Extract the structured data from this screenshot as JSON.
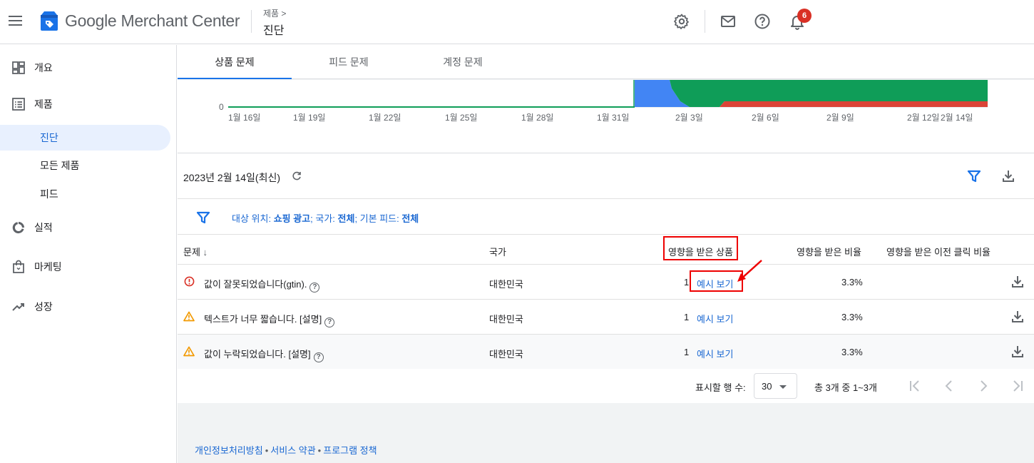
{
  "header": {
    "brand": "Google Merchant Center",
    "breadcrumb_parent": "제품 >",
    "breadcrumb_current": "진단",
    "notification_count": "6"
  },
  "sidebar": {
    "items": [
      {
        "label": "개요",
        "icon": "dashboard-icon"
      },
      {
        "label": "제품",
        "icon": "list-icon"
      },
      {
        "label": "진단",
        "sub": true,
        "active": true
      },
      {
        "label": "모든 제품",
        "sub": true
      },
      {
        "label": "피드",
        "sub": true
      },
      {
        "label": "실적",
        "icon": "donut-chart-icon"
      },
      {
        "label": "마케팅",
        "icon": "shopping-bag-icon"
      },
      {
        "label": "성장",
        "icon": "trending-up-icon"
      }
    ]
  },
  "tabs": [
    "상품 문제",
    "피드 문제",
    "계정 문제"
  ],
  "chart_data": {
    "type": "area",
    "y_tick": "0",
    "x_ticks": [
      "1월 16일",
      "1월 19일",
      "1월 22일",
      "1월 25일",
      "1월 28일",
      "1월 31일",
      "2월 3일",
      "2월 6일",
      "2월 9일",
      "2월 12일",
      "2월 14일"
    ],
    "series_colors": [
      "#4285f4",
      "#0f9d58",
      "#db4437"
    ]
  },
  "date_row": {
    "label": "2023년 2월 14일(최신)"
  },
  "filter": {
    "p1": "대상 위치: ",
    "v1": "쇼핑 광고",
    "p2": "; 국가: ",
    "v2": "전체",
    "p3": "; 기본 피드: ",
    "v3": "전체"
  },
  "table": {
    "headers": {
      "issue": "문제",
      "country": "국가",
      "affected": "영향을 받은 상품",
      "ratio": "영향을 받은 비율",
      "click_ratio": "영향을 받은 이전 클릭 비율"
    },
    "rows": [
      {
        "issue": "값이 잘못되었습니다(gtin).",
        "severity": "error",
        "country": "대한민국",
        "count": "1",
        "link": "예시 보기",
        "ratio": "3.3%"
      },
      {
        "issue": "텍스트가 너무 짧습니다. [설명]",
        "severity": "warning",
        "country": "대한민국",
        "count": "1",
        "link": "예시 보기",
        "ratio": "3.3%"
      },
      {
        "issue": "값이 누락되었습니다. [설명]",
        "severity": "warning",
        "country": "대한민국",
        "count": "1",
        "link": "예시 보기",
        "ratio": "3.3%"
      }
    ]
  },
  "pager": {
    "rows_label": "표시할 행 수:",
    "rows_value": "30",
    "range": "총 3개 중 1~3개"
  },
  "footer": {
    "privacy": "개인정보처리방침",
    "terms": "서비스 약관",
    "policy": "프로그램 정책",
    "sep": "•"
  }
}
